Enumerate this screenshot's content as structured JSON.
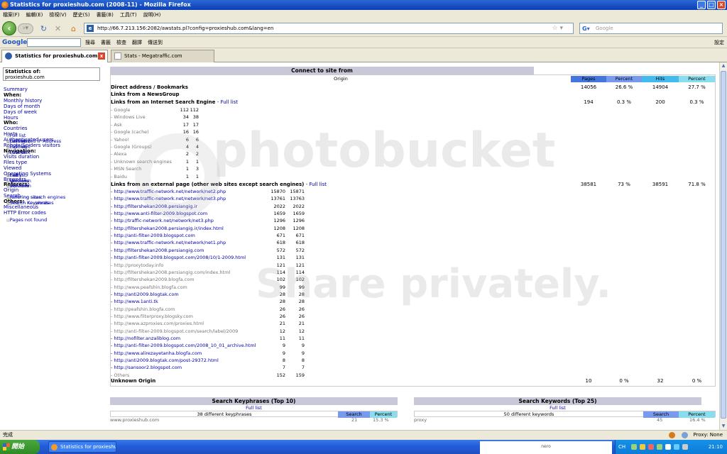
{
  "window": {
    "title": "Statistics for proxieshub.com (2008-11) - Mozilla Firefox"
  },
  "menubar": [
    "檔案(F)",
    "編輯(E)",
    "檢視(V)",
    "歷史(S)",
    "書籤(B)",
    "工具(T)",
    "說明(H)"
  ],
  "nav": {
    "url": "http://66.7.213.156:2082/awstats.pl?config=proxieshub.com&lang=en",
    "search_placeholder": "Google"
  },
  "gtoolbar": {
    "logo": "Google",
    "items": [
      "搜尋",
      "書籤",
      "檢查",
      "翻譯",
      "傳送到"
    ],
    "settings": "設定"
  },
  "tabs": [
    {
      "label": "Statistics for proxieshub.com (2...",
      "active": true
    },
    {
      "label": "Stats - Megatraffic.com",
      "active": false
    }
  ],
  "sidebar": {
    "stats_of": "Statistics of:",
    "site": "proxieshub.com",
    "items": [
      {
        "t": "Summary",
        "k": "link"
      },
      {
        "t": "When:",
        "k": "h"
      },
      {
        "t": "Monthly history",
        "k": "link"
      },
      {
        "t": "Days of month",
        "k": "link"
      },
      {
        "t": "Days of week",
        "k": "link"
      },
      {
        "t": "Hours",
        "k": "link"
      },
      {
        "t": "Who:",
        "k": "h"
      },
      {
        "t": "Countries",
        "k": "link"
      },
      {
        "t": "Full list",
        "k": "sub"
      },
      {
        "t": "Hosts",
        "k": "link"
      },
      {
        "t": "Full list",
        "k": "sub"
      },
      {
        "t": "Last visit",
        "k": "sub"
      },
      {
        "t": "Unresolved IP Address",
        "k": "sub"
      },
      {
        "t": "Authenticated users",
        "k": "link"
      },
      {
        "t": "Full list",
        "k": "sub"
      },
      {
        "t": "Last visit",
        "k": "sub"
      },
      {
        "t": "Robots/Spiders visitors",
        "k": "link"
      },
      {
        "t": "Full list",
        "k": "sub"
      },
      {
        "t": "Last visit",
        "k": "sub"
      },
      {
        "t": "Navigation:",
        "k": "h"
      },
      {
        "t": "Visits duration",
        "k": "link"
      },
      {
        "t": "Files type",
        "k": "link"
      },
      {
        "t": "Viewed",
        "k": "link"
      },
      {
        "t": "Full list",
        "k": "sub"
      },
      {
        "t": "Entry",
        "k": "sub"
      },
      {
        "t": "Exit",
        "k": "sub"
      },
      {
        "t": "Operating Systems",
        "k": "link"
      },
      {
        "t": "Versions",
        "k": "sub"
      },
      {
        "t": "Unknown",
        "k": "sub"
      },
      {
        "t": "Browsers",
        "k": "link"
      },
      {
        "t": "Versions",
        "k": "sub"
      },
      {
        "t": "Unknown",
        "k": "sub"
      },
      {
        "t": "Referers:",
        "k": "h"
      },
      {
        "t": "Origin",
        "k": "link"
      },
      {
        "t": "Refering search engines",
        "k": "sub"
      },
      {
        "t": "Refering sites",
        "k": "sub"
      },
      {
        "t": "Search",
        "k": "link"
      },
      {
        "t": "Search Keyphrases",
        "k": "sub"
      },
      {
        "t": "Search Keywords",
        "k": "sub"
      },
      {
        "t": "Others:",
        "k": "h"
      },
      {
        "t": "Miscellaneous",
        "k": "link"
      },
      {
        "t": "HTTP Error codes",
        "k": "link"
      },
      {
        "t": "Pages not found",
        "k": "sub"
      }
    ]
  },
  "main": {
    "title": "Connect to site from",
    "origin_header": "Origin",
    "columns": [
      "Pages",
      "Percent",
      "Hits",
      "Percent"
    ],
    "col_colors": [
      "#4477dd",
      "#7799ee",
      "#44bbee",
      "#88ddee"
    ],
    "rows": [
      {
        "label": "Direct address / Bookmarks",
        "full": "",
        "pages": "14056",
        "ppct": "26.6 %",
        "hits": "14904",
        "hpct": "27.7 %"
      },
      {
        "label": "Links from a NewsGroup",
        "full": "",
        "pages": "",
        "ppct": "",
        "hits": "",
        "hpct": ""
      },
      {
        "label": "Links from an Internet Search Engine",
        "full": "- Full list",
        "pages": "194",
        "ppct": "0.3 %",
        "hits": "200",
        "hpct": "0.3 %"
      },
      {
        "label": "Links from an external page (other web sites except search engines)",
        "full": "- Full list",
        "pages": "38581",
        "ppct": "73 %",
        "hits": "38591",
        "hpct": "71.8 %"
      },
      {
        "label": "Unknown Origin",
        "full": "",
        "pages": "10",
        "ppct": "0 %",
        "hits": "32",
        "hpct": "0 %"
      }
    ],
    "engines": [
      [
        "- Google",
        "112",
        "112"
      ],
      [
        "- Windows Live",
        "34",
        "38"
      ],
      [
        "- Ask",
        "17",
        "17"
      ],
      [
        "- Google (cache)",
        "16",
        "16"
      ],
      [
        "- Yahoo!",
        "6",
        "6"
      ],
      [
        "- Google (Groups)",
        "4",
        "4"
      ],
      [
        "- Alexa",
        "2",
        "2"
      ],
      [
        "- Unknown search engines",
        "1",
        "1"
      ],
      [
        "- MSN Search",
        "1",
        "3"
      ],
      [
        "- Baidu",
        "1",
        "1"
      ]
    ],
    "pages": [
      [
        "- http://www.traffic-network.net/network/net2.php",
        "15870",
        "15871",
        false
      ],
      [
        "- http://www.traffic-network.net/network/net3.php",
        "13761",
        "13763",
        false
      ],
      [
        "- http://filtershekan2008.persiangig.ir",
        "2022",
        "2022",
        false
      ],
      [
        "- http://www.anti-filter-2009.blogspot.com",
        "1659",
        "1659",
        false
      ],
      [
        "- http://traffic-network.net/network/net3.php",
        "1296",
        "1296",
        false
      ],
      [
        "- http://filtershekan2008.persiangig.ir/index.html",
        "1208",
        "1208",
        false
      ],
      [
        "- http://anti-filter-2009.blogspot.com",
        "671",
        "671",
        false
      ],
      [
        "- http://www.traffic-network.net/network/net1.php",
        "618",
        "618",
        false
      ],
      [
        "- http://filtershekan2008.persiangig.com",
        "572",
        "572",
        false
      ],
      [
        "- http://anti-filter-2009.blogspot.com/2008/10/1-2009.html",
        "131",
        "131",
        false
      ],
      [
        "- http://proxytoday.info",
        "121",
        "121",
        true
      ],
      [
        "- http://filtershekan2008.persiangig.com/index.html",
        "114",
        "114",
        true
      ],
      [
        "- http://filtershekan2009.blogfa.com",
        "102",
        "102",
        true
      ],
      [
        "- http://www.peafshin.blogfa.com",
        "99",
        "99",
        true
      ],
      [
        "- http://anti2009.blogtak.com",
        "28",
        "28",
        false
      ],
      [
        "- http://www.1anti.tk",
        "28",
        "28",
        false
      ],
      [
        "- http://peafshin.blogfa.com",
        "26",
        "26",
        true
      ],
      [
        "- http://www.filterproxy.blogsky.com",
        "26",
        "26",
        true
      ],
      [
        "- http://www.azproxies.com/proxies.html",
        "21",
        "21",
        true
      ],
      [
        "- http://anti-filter-2009.blogspot.com/search/label/2009",
        "12",
        "12",
        true
      ],
      [
        "- http://nofilter.anzaliblog.com",
        "11",
        "11",
        false
      ],
      [
        "- http://anti-filter-2009.blogspot.com/2008_10_01_archive.html",
        "9",
        "9",
        false
      ],
      [
        "- http://www.alirezayetanha.blogfa.com",
        "9",
        "9",
        false
      ],
      [
        "- http://anti2009.blogtak.com/post-29372.html",
        "8",
        "8",
        false
      ],
      [
        "- http://sansoor2.blogspot.com",
        "7",
        "7",
        false
      ],
      [
        "- Others",
        "152",
        "159",
        true
      ]
    ]
  },
  "keyphrases": {
    "title": "Search Keyphrases (Top 10)",
    "full": "Full list",
    "count": "38 different keyphrases",
    "cols": [
      "Search",
      "Percent"
    ],
    "first": "www.proxieshub.com",
    "first_n": "21",
    "first_p": "15.3 %"
  },
  "keywords": {
    "title": "Search Keywords (Top 25)",
    "full": "Full list",
    "count": "50 different keywords",
    "cols": [
      "Search",
      "Percent"
    ],
    "first": "proxy",
    "first_n": "45",
    "first_p": "16.4 %"
  },
  "watermark": {
    "a": "photobucket",
    "b": "Share privately."
  },
  "status": {
    "left": "完成",
    "proxy": "Proxy: None"
  },
  "taskbar": {
    "start": "開始",
    "task": "Statistics for proxieshu...",
    "ad": "nero",
    "clock": "21:10",
    "lang": "CH"
  }
}
